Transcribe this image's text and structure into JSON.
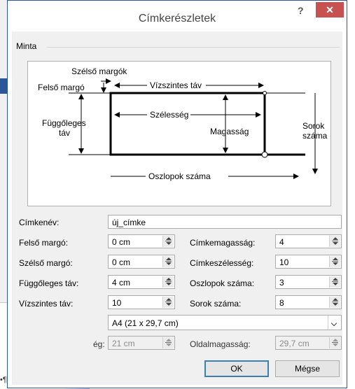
{
  "dialog": {
    "title": "Címkerészletek",
    "help": "?",
    "close": "✕"
  },
  "sample": {
    "legend": "Minta",
    "diagram": {
      "side_margins": "Szélső margók",
      "top_margin": "Felső margó",
      "horizontal_pitch": "Vízszintes táv",
      "vertical_pitch_1": "Függőleges",
      "vertical_pitch_2": "táv",
      "width": "Szélesség",
      "height": "Magasság",
      "rows_1": "Sorok",
      "rows_2": "száma",
      "columns": "Oszlopok száma"
    }
  },
  "form": {
    "label_name": {
      "label": "Címkenév:",
      "value": "új_címke"
    },
    "top_margin": {
      "label": "Felső margó:",
      "value": "0 cm"
    },
    "side_margin": {
      "label": "Szélső margó:",
      "value": "0 cm"
    },
    "vertical_pitch": {
      "label": "Függőleges táv:",
      "value": "4 cm"
    },
    "horizontal_pitch": {
      "label": "Vízszintes táv:",
      "value": "10"
    },
    "label_height": {
      "label": "Címkemagasság:",
      "value": "4"
    },
    "label_width": {
      "label": "Címkeszélesség:",
      "value": "10"
    },
    "columns": {
      "label": "Oszlopok száma:",
      "value": "3"
    },
    "rows": {
      "label": "Sorok száma:",
      "value": "8"
    },
    "page_size": {
      "value": "A4 (21 x 29,7 cm)"
    },
    "page_width": {
      "label": "ég:",
      "value": "21 cm"
    },
    "page_height": {
      "label": "Oldalmagasság:",
      "value": "29,7 cm"
    }
  },
  "buttons": {
    "ok": "OK",
    "cancel": "Mégse"
  },
  "background": {
    "mark1": "¤",
    "mark2": "•¶"
  },
  "colors": {
    "accent": "#2b579a",
    "close": "#c75050"
  }
}
